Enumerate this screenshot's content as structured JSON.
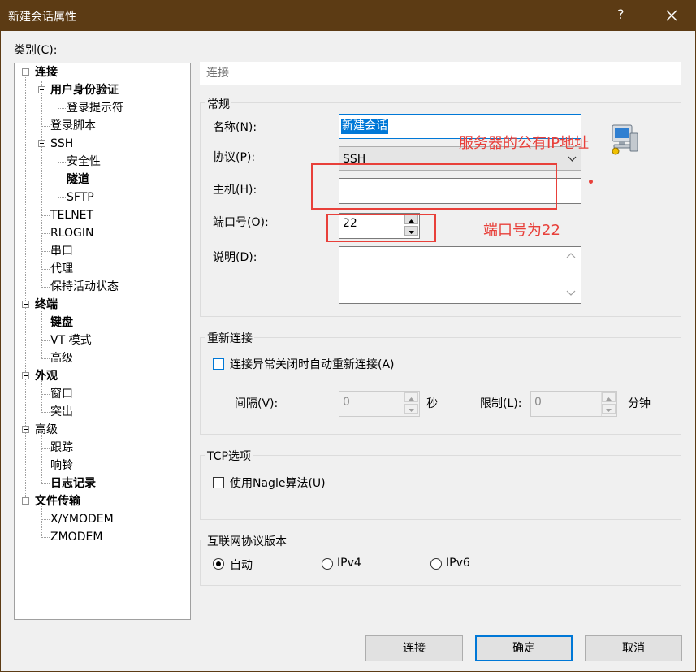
{
  "window": {
    "title": "新建会话属性",
    "help_label": "?",
    "close_icon": "close-icon"
  },
  "category_label": "类别(C):",
  "tree": [
    {
      "label": "连接",
      "bold": true
    },
    {
      "label": "用户身份验证",
      "bold": true
    },
    {
      "label": "登录提示符",
      "bold": false
    },
    {
      "label": "登录脚本",
      "bold": false
    },
    {
      "label": "SSH",
      "bold": false
    },
    {
      "label": "安全性",
      "bold": false
    },
    {
      "label": "隧道",
      "bold": true
    },
    {
      "label": "SFTP",
      "bold": false
    },
    {
      "label": "TELNET",
      "bold": false
    },
    {
      "label": "RLOGIN",
      "bold": false
    },
    {
      "label": "串口",
      "bold": false
    },
    {
      "label": "代理",
      "bold": false
    },
    {
      "label": "保持活动状态",
      "bold": false
    },
    {
      "label": "终端",
      "bold": true
    },
    {
      "label": "键盘",
      "bold": true
    },
    {
      "label": "VT 模式",
      "bold": false
    },
    {
      "label": "高级",
      "bold": false
    },
    {
      "label": "外观",
      "bold": true
    },
    {
      "label": "窗口",
      "bold": false
    },
    {
      "label": "突出",
      "bold": false
    },
    {
      "label": "高级",
      "bold": false
    },
    {
      "label": "跟踪",
      "bold": false
    },
    {
      "label": "响铃",
      "bold": false
    },
    {
      "label": "日志记录",
      "bold": true
    },
    {
      "label": "文件传输",
      "bold": true
    },
    {
      "label": "X/YMODEM",
      "bold": false
    },
    {
      "label": "ZMODEM",
      "bold": false
    }
  ],
  "pane_header": "连接",
  "general": {
    "title": "常规",
    "name_label": "名称(N):",
    "name_value": "新建会话",
    "protocol_label": "协议(P):",
    "protocol_value": "SSH",
    "host_label": "主机(H):",
    "host_value": "",
    "port_label": "端口号(O):",
    "port_value": "22",
    "desc_label": "说明(D):",
    "desc_value": ""
  },
  "reconnect": {
    "title": "重新连接",
    "auto_label": "连接异常关闭时自动重新连接(A)",
    "auto_checked": false,
    "interval_label": "间隔(V):",
    "interval_value": "0",
    "interval_unit": "秒",
    "limit_label": "限制(L):",
    "limit_value": "0",
    "limit_unit": "分钟"
  },
  "tcp": {
    "title": "TCP选项",
    "nagle_label": "使用Nagle算法(U)",
    "nagle_checked": false
  },
  "ipver": {
    "title": "互联网协议版本",
    "options": [
      "自动",
      "IPv4",
      "IPv6"
    ],
    "selected": "自动"
  },
  "buttons": {
    "connect": "连接",
    "ok": "确定",
    "cancel": "取消"
  },
  "annotations": {
    "host_note": "服务器的公有IP地址",
    "port_note": "端口号为22",
    "color": "#e8403a"
  },
  "colors": {
    "titlebar": "#5c3b14",
    "selection": "#0078d7"
  }
}
